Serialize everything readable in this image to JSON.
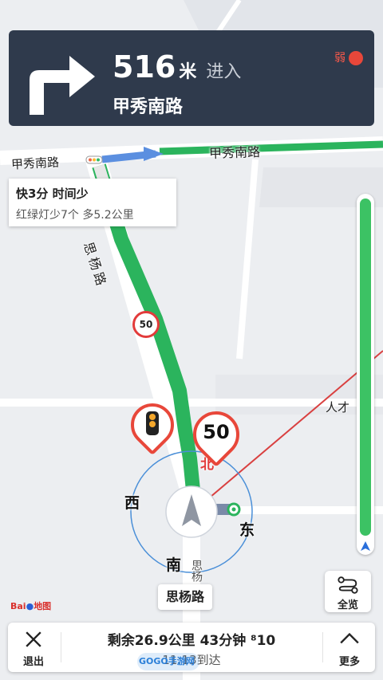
{
  "banner": {
    "distance": "516",
    "unit": "米",
    "action": "进入",
    "road": "甲秀南路",
    "signal_label": "弱",
    "turn_icon": "turn-right-icon"
  },
  "route_tip": {
    "title": "快3分 时间少",
    "detail": "红绿灯少7个 多5.2公里"
  },
  "map": {
    "labels": {
      "road_top_left": "甲秀南路",
      "road_top_right": "甲秀南路",
      "road_vertical": "思杨路",
      "road_bottom_vertical": "思杨",
      "place": "人才"
    },
    "compass": {
      "north": "北",
      "south": "南",
      "east": "东",
      "west": "西"
    },
    "speed_limit_small": "50",
    "speed_limit_big": "50"
  },
  "progress": {
    "fraction": 0.96
  },
  "overview": {
    "label": "全览"
  },
  "current_road": {
    "label": "思杨路"
  },
  "logo": {
    "text": "Bai",
    "text2": "地图"
  },
  "bottom": {
    "exit_label": "退出",
    "more_label": "更多",
    "remaining": "剩余26.9公里 43分钟 ⁸10",
    "eta": "11:13到达",
    "watermark": "GOGO手游网"
  },
  "colors": {
    "route": "#2bb45d",
    "banner_bg": "#2f3a4c",
    "alert_red": "#e8473a"
  }
}
